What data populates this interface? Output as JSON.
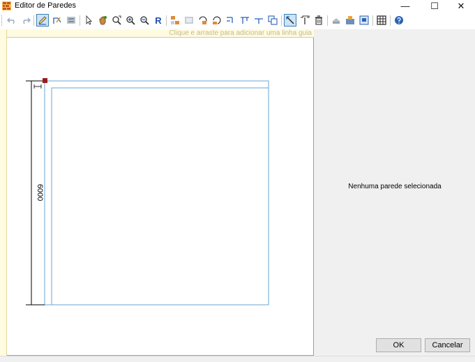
{
  "window": {
    "title": "Editor de Paredes",
    "minimize_glyph": "—",
    "maximize_glyph": "☐",
    "close_glyph": "✕"
  },
  "toolbar": {
    "buttons": [
      {
        "name": "undo-button",
        "icon": "undo-icon"
      },
      {
        "name": "redo-button",
        "icon": "redo-icon"
      },
      {
        "name": "draw-wall-button",
        "icon": "pencil-icon",
        "active": true
      },
      {
        "name": "draw-polyline-button",
        "icon": "polyline-icon"
      },
      {
        "name": "wall-properties-button",
        "icon": "properties-icon"
      },
      {
        "name": "select-button",
        "icon": "pointer-icon"
      },
      {
        "name": "pan-button",
        "icon": "hand-icon"
      },
      {
        "name": "zoom-window-button",
        "icon": "zoom-window-icon"
      },
      {
        "name": "zoom-in-button",
        "icon": "zoom-in-icon"
      },
      {
        "name": "zoom-out-button",
        "icon": "zoom-out-icon"
      },
      {
        "name": "redraw-button",
        "icon": "redraw-icon",
        "label": "R"
      },
      {
        "name": "split-wall-button",
        "icon": "split-icon"
      },
      {
        "name": "join-wall-button",
        "icon": "join-icon"
      },
      {
        "name": "rotate-button",
        "icon": "rotate-icon"
      },
      {
        "name": "mirror-button",
        "icon": "mirror-icon"
      },
      {
        "name": "align-left-button",
        "icon": "align-left-icon"
      },
      {
        "name": "align-top-button",
        "icon": "align-top-icon"
      },
      {
        "name": "align-bottom-button",
        "icon": "align-bottom-icon"
      },
      {
        "name": "copy-button",
        "icon": "copy-icon"
      },
      {
        "name": "dimension-button",
        "icon": "dimension-icon",
        "active": true
      },
      {
        "name": "measure-button",
        "icon": "measure-icon"
      },
      {
        "name": "delete-button",
        "icon": "trash-icon"
      },
      {
        "name": "roof-button",
        "icon": "roof-icon"
      },
      {
        "name": "import-button",
        "icon": "import-icon"
      },
      {
        "name": "view-3d-button",
        "icon": "view-icon"
      },
      {
        "name": "grid-button",
        "icon": "grid-icon"
      },
      {
        "name": "help-button",
        "icon": "help-icon"
      }
    ]
  },
  "canvas": {
    "guide_hint": "Clique e arraste para adicionar uma linha guia",
    "dimension_label": "6000"
  },
  "panel": {
    "no_selection_text": "Nenhuma parede selecionada",
    "ok_label": "OK",
    "cancel_label": "Cancelar"
  },
  "colors": {
    "wall_stroke": "#6aa6d6",
    "handle": "#9b1b1b",
    "dimension_line": "#000000",
    "accent_active": "#cce4f7"
  }
}
